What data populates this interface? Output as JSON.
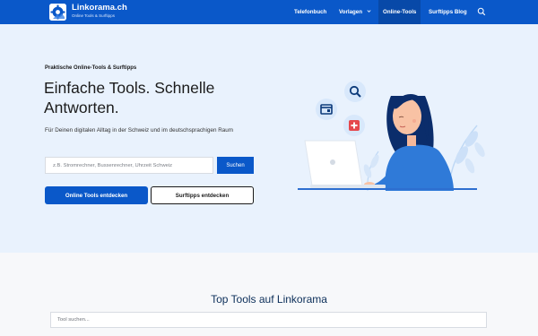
{
  "header": {
    "logo_icon": "gear-icon",
    "logo_title": "Linkorama.ch",
    "logo_subtitle": "Online Tools & Surftipps",
    "nav": [
      {
        "label": "Telefonbuch",
        "active": false
      },
      {
        "label": "Vorlagen",
        "active": false,
        "has_dropdown": true
      },
      {
        "label": "Online-Tools",
        "active": true
      },
      {
        "label": "Surftipps Blog",
        "active": false
      }
    ],
    "search_icon": "search-icon"
  },
  "hero": {
    "kicker": "Praktische Online-Tools & Surftipps",
    "headline": "Einfache Tools. Schnelle Antworten.",
    "intro": "Für Deinen digitalen Alltag in der Schweiz und im deutschsprachigen Raum",
    "search": {
      "placeholder": "z.B. Stromrechner, Bussenrechner, Uhrzeit Schweiz",
      "button_label": "Suchen"
    },
    "primary_button": "Online Tools entdecken",
    "secondary_button": "Surftipps entdecken",
    "illustration_icons": [
      "search-icon",
      "calendar-icon",
      "medical-cross-icon"
    ]
  },
  "tools_section": {
    "title": "Top Tools auf Linkorama",
    "search_placeholder": "Tool suchen..."
  },
  "colors": {
    "brand_blue": "#0a58c9",
    "hero_bg": "#e9f2fd",
    "page_bg": "#f7f8fa",
    "title_navy": "#0b2e59",
    "accent_red": "#e5484d"
  }
}
